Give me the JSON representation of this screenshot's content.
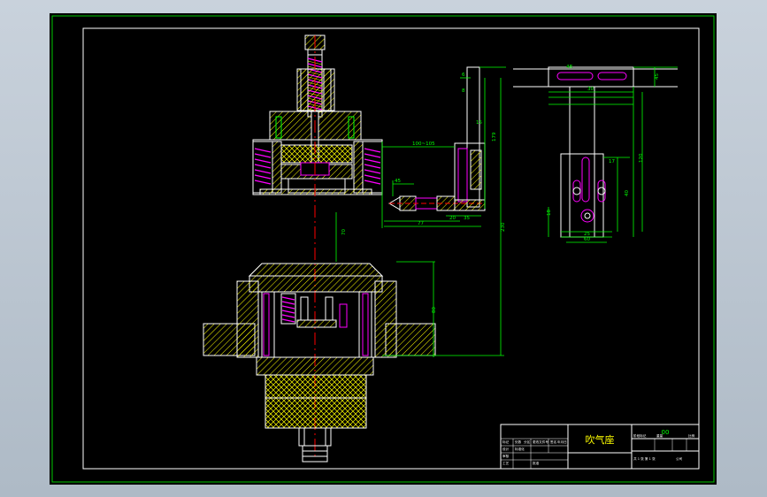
{
  "title_block": {
    "drawing_title": "吹气座",
    "drawing_number": "00",
    "cell_labels": [
      "标记",
      "处数",
      "分区",
      "更改文件号",
      "签名",
      "年月日",
      "设计",
      "标准化",
      "审核",
      "工艺",
      "批准",
      "阶段标记",
      "重量",
      "比例"
    ],
    "company_label": "公司",
    "sheet_label": "共 1 张 第 1 张"
  },
  "dimensions": {
    "nozzle_span": "100~105",
    "nozzle_len": "45",
    "lower_77": "77",
    "lower_20": "20",
    "lower_35": "35",
    "bracket_6": "6",
    "bracket_8": "8",
    "bracket_15": "15",
    "bracket_179": "179",
    "total_230": "230",
    "base_70": "70",
    "base_80": "80",
    "side_48": "48",
    "side_45": "45",
    "side_30": "30",
    "side_120": "120",
    "side_40": "40",
    "side_17": "17",
    "side_25": "25",
    "side_18": "18",
    "side_60": "60"
  },
  "colors": {
    "background": "#000000",
    "outline": "#ffffff",
    "dimension": "#00ff00",
    "hatch": "#ffff00",
    "center": "#ff0000",
    "highlight": "#ff00ff",
    "frame": "#00c800"
  }
}
